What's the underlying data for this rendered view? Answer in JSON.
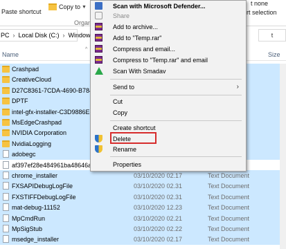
{
  "ribbon": {
    "paste_shortcut": "Paste shortcut",
    "copy_to": "Copy to",
    "organize": "Organiz",
    "none": "t none",
    "invert_selection": "rt selection"
  },
  "address": {
    "path": [
      "PC",
      "Local Disk (C:)",
      "Windows"
    ],
    "right_fragment": "t"
  },
  "columns": {
    "name": "Name",
    "size": "Size"
  },
  "files": [
    {
      "name": "Crashpad",
      "date": "",
      "type": "",
      "kind": "folder",
      "selected": true
    },
    {
      "name": "CreativeCloud",
      "date": "",
      "type": "",
      "kind": "folder",
      "selected": true
    },
    {
      "name": "D27C8361-7CDA-4690-B784-D4",
      "date": "",
      "type": "",
      "kind": "folder",
      "selected": true
    },
    {
      "name": "DPTF",
      "date": "",
      "type": "",
      "kind": "folder",
      "selected": true
    },
    {
      "name": "intel-gfx-installer-C3D9886E-5D",
      "date": "",
      "type": "",
      "kind": "folder",
      "selected": true
    },
    {
      "name": "MsEdgeCrashpad",
      "date": "",
      "type": "",
      "kind": "folder",
      "selected": true
    },
    {
      "name": "NVIDIA Corporation",
      "date": "",
      "type": "",
      "kind": "folder",
      "selected": true
    },
    {
      "name": "NvidiaLogging",
      "date": "",
      "type": "",
      "kind": "folder",
      "selected": true
    },
    {
      "name": "adobegc",
      "date": "",
      "type": "",
      "kind": "doc",
      "selected": true
    },
    {
      "name": "af397ef28e484961ba48646a5d38",
      "date": "",
      "type": "",
      "kind": "doc",
      "selected": false
    },
    {
      "name": "chrome_installer",
      "date": "03/10/2020 02.17",
      "type": "Text Document",
      "kind": "doc",
      "selected": true
    },
    {
      "name": "FXSAPIDebugLogFile",
      "date": "03/10/2020 02.31",
      "type": "Text Document",
      "kind": "doc",
      "selected": true
    },
    {
      "name": "FXSTIFFDebugLogFile",
      "date": "03/10/2020 02.31",
      "type": "Text Document",
      "kind": "doc",
      "selected": true
    },
    {
      "name": "mat-debug-11152",
      "date": "03/10/2020 12.23",
      "type": "Text Document",
      "kind": "doc",
      "selected": true
    },
    {
      "name": "MpCmdRun",
      "date": "03/10/2020 02.21",
      "type": "Text Document",
      "kind": "doc",
      "selected": true
    },
    {
      "name": "MpSigStub",
      "date": "03/10/2020 02.22",
      "type": "Text Document",
      "kind": "doc",
      "selected": true
    },
    {
      "name": "msedge_installer",
      "date": "03/10/2020 02.17",
      "type": "Text Document",
      "kind": "doc",
      "selected": true
    }
  ],
  "context_menu": {
    "scan_defender": "Scan with Microsoft Defender...",
    "share": "Share",
    "add_archive": "Add to archive...",
    "add_temp_rar": "Add to \"Temp.rar\"",
    "compress_email": "Compress and email...",
    "compress_temp_email": "Compress to \"Temp.rar\" and email",
    "scan_smadav": "Scan With Smadav",
    "send_to": "Send to",
    "cut": "Cut",
    "copy": "Copy",
    "create_shortcut": "Create shortcut",
    "delete": "Delete",
    "rename": "Rename",
    "properties": "Properties"
  },
  "colors": {
    "selection": "#cce8ff",
    "highlight_box": "#d62b2b"
  }
}
